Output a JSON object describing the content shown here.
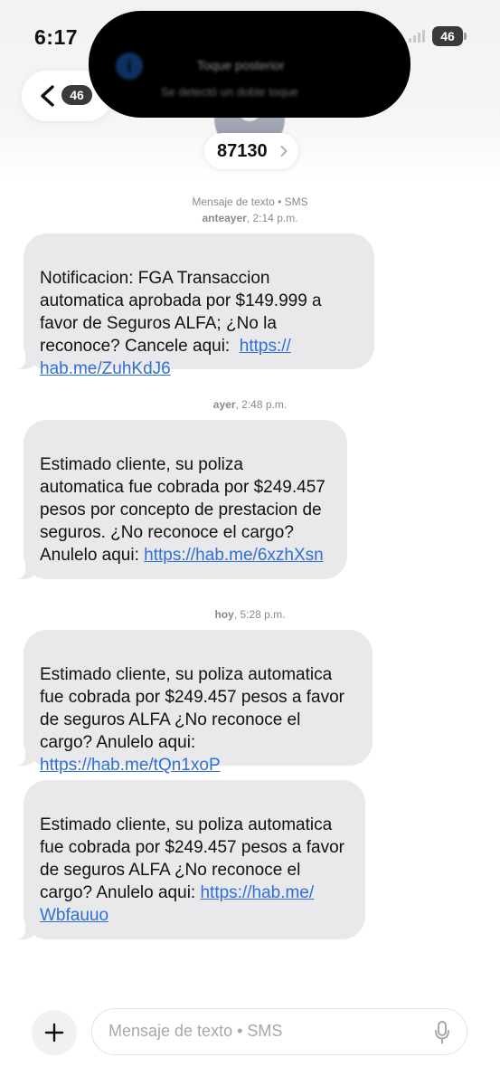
{
  "status_bar": {
    "time": "6:17",
    "battery": "46"
  },
  "header": {
    "back_badge": "46",
    "contact": "87130"
  },
  "dynamic_island": {
    "title": "Toque posterior",
    "subtitle": "Se detectó un doble toque"
  },
  "conversation": {
    "service_label": "Mensaje de texto • SMS",
    "timestamps": [
      {
        "day": "anteayer",
        "time": "2:14 p.m."
      },
      {
        "day": "ayer",
        "time": "2:48 p.m."
      },
      {
        "day": "hoy",
        "time": "5:28 p.m."
      }
    ],
    "messages": [
      {
        "text": "Notificacion: FGA Transaccion automatica aprobada por $149.999 a favor de Seguros ALFA; ¿No la reconoce? Cancele aqui:",
        "link": "https://hab.me/ZuhKdJ6",
        "link_lines": [
          "https://",
          "hab.me/ZuhKdJ6"
        ]
      },
      {
        "text": "Estimado cliente, su poliza automatica fue cobrada por $249.457 pesos por concepto de prestacion de seguros. ¿No reconoce el cargo? Anulelo aqui:",
        "link": "https://hab.me/6xzhXsn"
      },
      {
        "text": "Estimado cliente, su poliza automatica fue cobrada por $249.457 pesos a favor de seguros ALFA ¿No reconoce el cargo? Anulelo aqui:",
        "link": "https://hab.me/tQn1xoP"
      },
      {
        "text": "Estimado cliente, su poliza automatica fue cobrada por $249.457 pesos a favor de seguros ALFA ¿No reconoce el cargo? Anulelo aqui:",
        "link": "https://hab.me/Wbfauuo",
        "link_lines": [
          "https://hab.me/",
          "Wbfauuo"
        ]
      }
    ]
  },
  "composer": {
    "placeholder": "Mensaje de texto • SMS"
  },
  "icons": {
    "back": "chevron-left-icon",
    "contact": "chevron-right-icon",
    "attach": "plus-icon",
    "dictation": "mic-icon",
    "notification": "info-icon"
  },
  "colors": {
    "link": "#2f6fd6",
    "bubble": "#e9e9eb",
    "badge": "#3a3a3c"
  }
}
